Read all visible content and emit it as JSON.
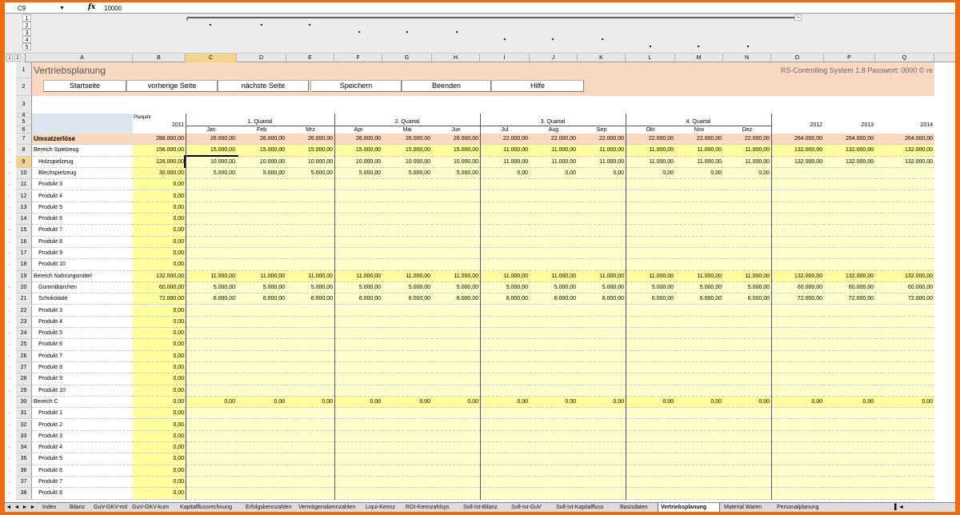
{
  "formula_bar": {
    "cell_ref": "C9",
    "dropdown": "▼",
    "fx": "fx",
    "value": "10000"
  },
  "outline": {
    "levels": [
      "1",
      "2",
      "3",
      "4",
      "5"
    ],
    "row_levels": [
      "1",
      "2"
    ],
    "collapse_button": "−"
  },
  "column_headers": [
    "A",
    "B",
    "C",
    "D",
    "E",
    "F",
    "G",
    "H",
    "I",
    "J",
    "K",
    "L",
    "M",
    "N",
    "O",
    "P",
    "Q"
  ],
  "selected_column": "C",
  "title": "Vertriebsplanung",
  "system_info": "RS-Controlling System 1.8    Passwort: 0000  © re",
  "nav_buttons": [
    "Startseite",
    "vorherige Seite",
    "nächste Seite",
    "Speichern",
    "Beenden",
    "Hilfe"
  ],
  "header": {
    "plan_year_label": "Planjahr",
    "plan_year": "2011",
    "quarters": [
      "1. Quartal",
      "2. Quartal",
      "3. Quartal",
      "4. Quartal"
    ],
    "months": [
      "Jan",
      "Feb",
      "Mrz",
      "Apr",
      "Mai",
      "Jun",
      "Jul",
      "Aug",
      "Sep",
      "Okt",
      "Nov",
      "Dez"
    ],
    "future_years": [
      "2012",
      "2013",
      "2014"
    ]
  },
  "rows": [
    {
      "num": "7",
      "label": "Umsatzerlöse",
      "type": "total",
      "values": [
        "288.000,00",
        "26.000,00",
        "26.000,00",
        "26.000,00",
        "26.000,00",
        "26.000,00",
        "26.000,00",
        "22.000,00",
        "22.000,00",
        "22.000,00",
        "22.000,00",
        "22.000,00",
        "22.000,00",
        "264.000,00",
        "264.000,00",
        "264.000,00"
      ]
    },
    {
      "num": "8",
      "label": "Bereich Spielzeug",
      "type": "section",
      "values": [
        "156.000,00",
        "15.000,00",
        "15.000,00",
        "15.000,00",
        "15.000,00",
        "15.000,00",
        "15.000,00",
        "11.000,00",
        "11.000,00",
        "11.000,00",
        "11.000,00",
        "11.000,00",
        "11.000,00",
        "132.000,00",
        "132.000,00",
        "132.000,00"
      ]
    },
    {
      "num": "9",
      "label": "Holzspielzeug",
      "type": "item",
      "values": [
        "126.000,00",
        "10.000,00",
        "10.000,00",
        "10.000,00",
        "10.000,00",
        "10.000,00",
        "10.000,00",
        "11.000,00",
        "11.000,00",
        "11.000,00",
        "11.000,00",
        "11.000,00",
        "11.000,00",
        "132.000,00",
        "132.000,00",
        "132.000,00"
      ]
    },
    {
      "num": "10",
      "label": "Blechspielzeug",
      "type": "item",
      "values": [
        "30.000,00",
        "5.000,00",
        "5.000,00",
        "5.000,00",
        "5.000,00",
        "5.000,00",
        "5.000,00",
        "0,00",
        "0,00",
        "0,00",
        "0,00",
        "0,00",
        "0,00",
        "",
        "",
        ""
      ]
    },
    {
      "num": "11",
      "label": "Produkt 3",
      "type": "item",
      "values": [
        "0,00"
      ]
    },
    {
      "num": "12",
      "label": "Produkt 4",
      "type": "item",
      "values": [
        "0,00"
      ]
    },
    {
      "num": "13",
      "label": "Produkt 5",
      "type": "item",
      "values": [
        "0,00"
      ]
    },
    {
      "num": "14",
      "label": "Produkt 6",
      "type": "item",
      "values": [
        "0,00"
      ]
    },
    {
      "num": "15",
      "label": "Produkt 7",
      "type": "item",
      "values": [
        "0,00"
      ]
    },
    {
      "num": "16",
      "label": "Produkt 8",
      "type": "item",
      "values": [
        "0,00"
      ]
    },
    {
      "num": "17",
      "label": "Produkt 9",
      "type": "item",
      "values": [
        "0,00"
      ]
    },
    {
      "num": "18",
      "label": "Produkt 10",
      "type": "item",
      "values": [
        "0,00"
      ]
    },
    {
      "num": "19",
      "label": "Bereich Nahrungsmittel",
      "type": "section",
      "values": [
        "132.000,00",
        "11.000,00",
        "11.000,00",
        "11.000,00",
        "11.000,00",
        "11.000,00",
        "11.000,00",
        "11.000,00",
        "11.000,00",
        "11.000,00",
        "11.000,00",
        "11.000,00",
        "11.000,00",
        "132.000,00",
        "132.000,00",
        "132.000,00"
      ]
    },
    {
      "num": "20",
      "label": "Gummibärchen",
      "type": "item",
      "values": [
        "60.000,00",
        "5.000,00",
        "5.000,00",
        "5.000,00",
        "5.000,00",
        "5.000,00",
        "5.000,00",
        "5.000,00",
        "5.000,00",
        "5.000,00",
        "5.000,00",
        "5.000,00",
        "5.000,00",
        "60.000,00",
        "60.000,00",
        "60.000,00"
      ]
    },
    {
      "num": "21",
      "label": "Schokolade",
      "type": "item",
      "values": [
        "72.000,00",
        "6.000,00",
        "6.000,00",
        "6.000,00",
        "6.000,00",
        "6.000,00",
        "6.000,00",
        "6.000,00",
        "6.000,00",
        "6.000,00",
        "6.000,00",
        "6.000,00",
        "6.000,00",
        "72.000,00",
        "72.000,00",
        "72.000,00"
      ]
    },
    {
      "num": "22",
      "label": "Produkt 3",
      "type": "item",
      "values": [
        "0,00"
      ]
    },
    {
      "num": "23",
      "label": "Produkt 4",
      "type": "item",
      "values": [
        "0,00"
      ]
    },
    {
      "num": "24",
      "label": "Produkt 5",
      "type": "item",
      "values": [
        "0,00"
      ]
    },
    {
      "num": "25",
      "label": "Produkt 6",
      "type": "item",
      "values": [
        "0,00"
      ]
    },
    {
      "num": "26",
      "label": "Produkt 7",
      "type": "item",
      "values": [
        "0,00"
      ]
    },
    {
      "num": "27",
      "label": "Produkt 8",
      "type": "item",
      "values": [
        "0,00"
      ]
    },
    {
      "num": "28",
      "label": "Produkt 9",
      "type": "item",
      "values": [
        "0,00"
      ]
    },
    {
      "num": "29",
      "label": "Produkt 10",
      "type": "item",
      "values": [
        "0,00"
      ]
    },
    {
      "num": "30",
      "label": "Bereich C",
      "type": "section",
      "values": [
        "0,00",
        "0,00",
        "0,00",
        "0,00",
        "0,00",
        "0,00",
        "0,00",
        "0,00",
        "0,00",
        "0,00",
        "0,00",
        "0,00",
        "0,00",
        "0,00",
        "0,00",
        "0,00"
      ]
    },
    {
      "num": "31",
      "label": "Produkt 1",
      "type": "item",
      "values": [
        "0,00"
      ]
    },
    {
      "num": "32",
      "label": "Produkt 2",
      "type": "item",
      "values": [
        "0,00"
      ]
    },
    {
      "num": "33",
      "label": "Produkt 3",
      "type": "item",
      "values": [
        "0,00"
      ]
    },
    {
      "num": "34",
      "label": "Produkt 4",
      "type": "item",
      "values": [
        "0,00"
      ]
    },
    {
      "num": "35",
      "label": "Produkt 5",
      "type": "item",
      "values": [
        "0,00"
      ]
    },
    {
      "num": "36",
      "label": "Produkt 6",
      "type": "item",
      "values": [
        "0,00"
      ]
    },
    {
      "num": "37",
      "label": "Produkt 7",
      "type": "item",
      "values": [
        "0,00"
      ]
    },
    {
      "num": "38",
      "label": "Produkt 8",
      "type": "item",
      "values": [
        "0,00"
      ]
    }
  ],
  "sheet_tabs": {
    "nav": [
      "◄",
      "◄",
      "►",
      "►"
    ],
    "tabs": [
      "Index",
      "Bilanz",
      "GuV-GKV-mtl",
      "GuV-GKV-kum",
      "Kapitalflussrechnung",
      "Erfolgskennzahlen",
      "Vermögenskennzahlen",
      "Liqui-Kennz",
      "ROI-Kennzahlsys",
      "Soll-Ist-Bilanz",
      "Soll-Ist-GuV",
      "Soll-Ist-Kapitalfluss",
      "Basisdaten",
      "Vertriebsplanung",
      "Material Waren",
      "Personalplanung"
    ],
    "active": "Vertriebsplanung",
    "overflow": "▌◄"
  },
  "colors": {
    "frame": "#f06a0f",
    "title_bg": "#fbd9c0",
    "header_bg": "#dce6f1",
    "total_bg": "#fbd9c0",
    "section_bg": "#ffff9e",
    "input_bg": "#ffffcc",
    "selection": "#f5d58d"
  }
}
